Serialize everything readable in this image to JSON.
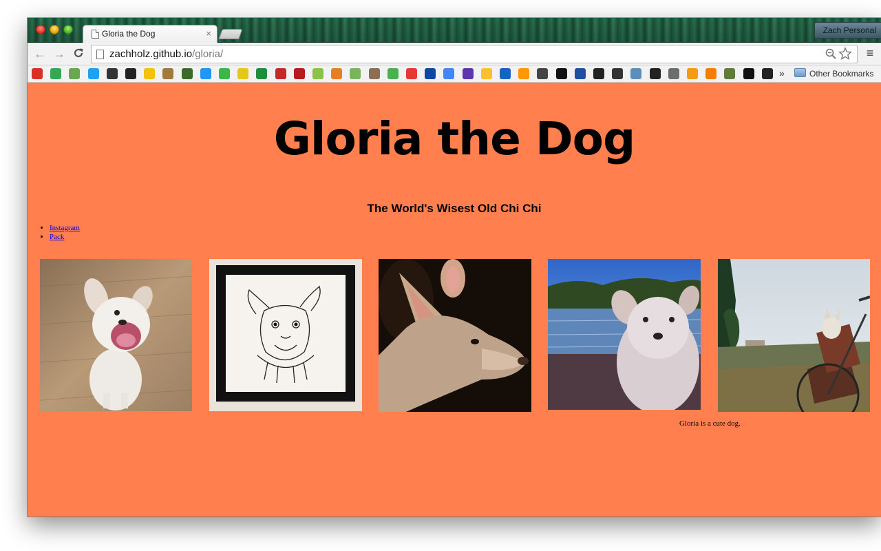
{
  "window": {
    "tab_title": "Gloria the Dog",
    "tab_close": "×",
    "profile_name": "Zach Personal"
  },
  "toolbar": {
    "back_icon": "←",
    "forward_icon": "→",
    "reload_icon": "C",
    "url_host": "zachholz.github.io",
    "url_path": "/gloria/",
    "menu_icon": "≡"
  },
  "bookmarks": {
    "overflow_icon": "»",
    "folder_label": "Other Bookmarks",
    "icons": [
      "gmail-icon",
      "maps-icon",
      "android-icon",
      "twitter-icon",
      "disqus-icon",
      "plus-icon",
      "circle-icon",
      "goodreads-icon",
      "trees-icon",
      "blue-square-icon",
      "evernote-icon",
      "kmhd-icon",
      "sheets-icon",
      "os-icon",
      "w-icon",
      "arc-icon",
      "squirrel-icon",
      "shopify-icon",
      "mailchimp-icon",
      "cloud-icon",
      "target-icon",
      "tl-icon",
      "google-icon",
      "fedex-icon",
      "dhl-icon",
      "usps-icon",
      "ups-icon",
      "wikipedia-icon",
      "o-icon",
      "bucket-icon",
      "nyt-icon",
      "runner-icon",
      "shape-icon",
      "bike-icon",
      "hands-icon",
      "p-icon",
      "blogger-icon",
      "greenhouse-icon",
      "black-square-icon",
      "github-icon"
    ]
  },
  "page": {
    "title": "Gloria the Dog",
    "subtitle": "The World's Wisest Old Chi Chi",
    "links": [
      "Instagram",
      "Pack"
    ],
    "caption": "Gloria is a cute dog."
  }
}
